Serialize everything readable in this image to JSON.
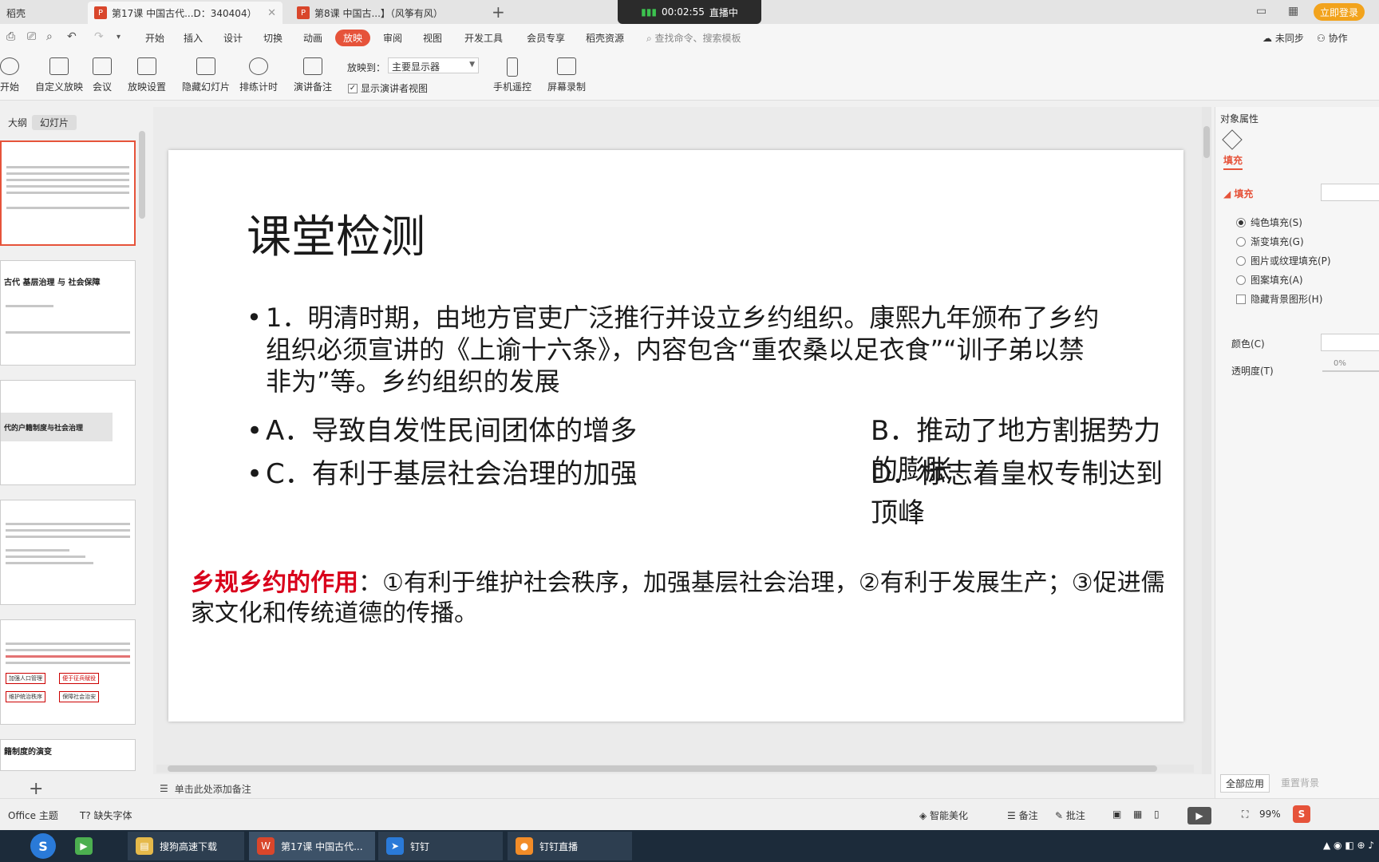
{
  "tabs": [
    {
      "label": "稻壳"
    },
    {
      "label": "第17课 中国古代...D：340404）"
    },
    {
      "label": "第8课 中国古...】（风筝有风）"
    }
  ],
  "live": {
    "time": "00:02:55",
    "status": "直播中"
  },
  "login_button": "立即登录",
  "menu": [
    "开始",
    "插入",
    "设计",
    "切换",
    "动画",
    "放映",
    "审阅",
    "视图",
    "开发工具",
    "会员专享",
    "稻壳资源"
  ],
  "search_placeholder": "查找命令、搜索模板",
  "menu_right": {
    "sync": "未同步",
    "collab": "协作"
  },
  "ribbon": {
    "start": "开始",
    "custom_show": "自定义放映",
    "meeting": "会议",
    "show_settings": "放映设置",
    "hide_slide": "隐藏幻灯片",
    "rehearse": "排练计时",
    "notes": "演讲备注",
    "show_to_label": "放映到：",
    "show_to_value": "主要显示器",
    "presenter_view": "显示演讲者视图",
    "phone_remote": "手机遥控",
    "screen_record": "屏幕录制"
  },
  "left_tabs": {
    "outline": "大纲",
    "slides": "幻灯片"
  },
  "thumbnails": {
    "t2_title": "古代 基层治理 与 社会保障",
    "t3_title": "代的户籍制度与社会治理",
    "t6_title": "籍制度的演变",
    "t5_boxes": [
      "加强人口管理",
      "便于征兵赋役",
      "维护统治秩序",
      "保障社会治安"
    ]
  },
  "slide": {
    "title": "课堂检测",
    "question": "1．明清时期，由地方官吏广泛推行并设立乡约组织。康熙九年颁布了乡约组织必须宣讲的《上谕十六条》，内容包含“重农桑以足衣食”“训子弟以禁非为”等。乡约组织的发展",
    "optA": "A．导致自发性民间团体的增多",
    "optB": "B．推动了地方割据势力的膨胀",
    "optC": "C．有利于基层社会治理的加强",
    "optD": "D．标志着皇权专制达到顶峰",
    "answer_label": "乡规乡约的作用",
    "answer_text": "：①有利于维护社会秩序，加强基层社会治理，②有利于发展生产；③促进儒家文化和传统道德的传播。"
  },
  "notes_placeholder": "单击此处添加备注",
  "right_panel": {
    "title": "对象属性",
    "fill_tab": "填充",
    "fill_section": "填充",
    "options": [
      "纯色填充(S)",
      "渐变填充(G)",
      "图片或纹理填充(P)",
      "图案填充(A)"
    ],
    "hide_bg": "隐藏背景图形(H)",
    "color": "颜色(C)",
    "transparency": "透明度(T)",
    "transparency_value": "0%",
    "apply_all": "全部应用",
    "reset_bg": "重置背景"
  },
  "status": {
    "theme": "Office 主题",
    "missing_font": "缺失字体",
    "beautify": "智能美化",
    "notes": "备注",
    "comment": "批注",
    "zoom": "99%"
  },
  "taskbar": [
    {
      "label": "搜狗高速下载"
    },
    {
      "label": "第17课 中国古代..."
    },
    {
      "label": "钉钉"
    },
    {
      "label": "钉钉直播"
    }
  ],
  "colors": {
    "accent": "#e6533a",
    "answer_red": "#d9001b"
  }
}
